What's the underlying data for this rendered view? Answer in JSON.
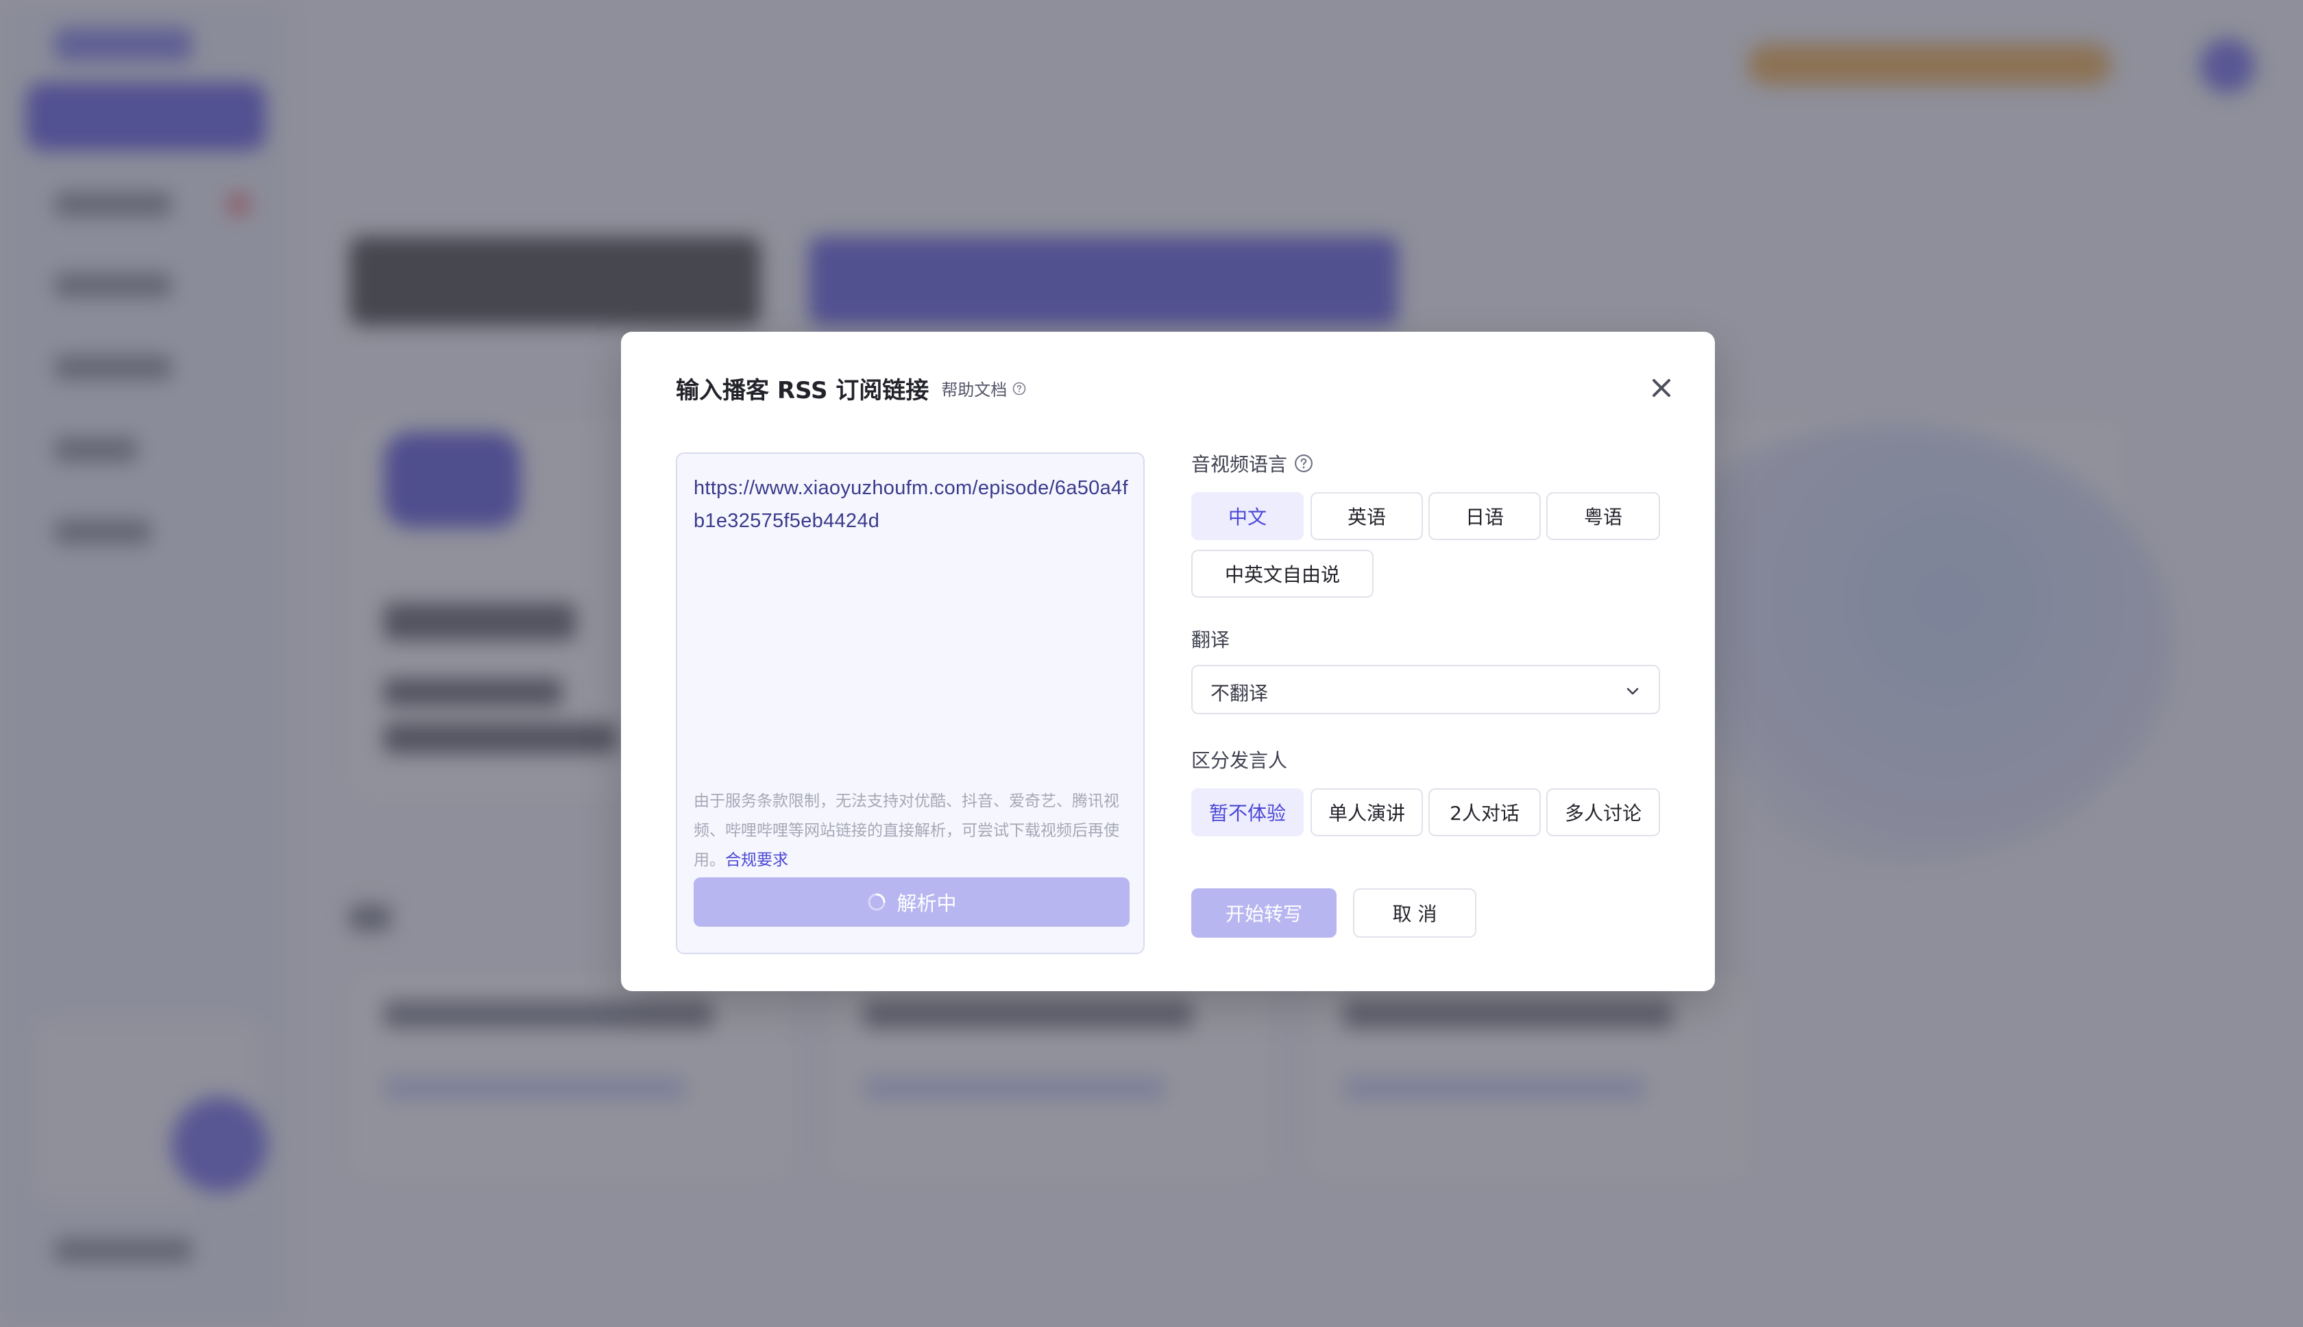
{
  "modal": {
    "title": "输入播客 RSS 订阅链接",
    "help_link": "帮助文档",
    "url_value": "https://www.xiaoyuzhoufm.com/episode/6a50a4fb1e32575f5eb4424d",
    "notice_text": "由于服务条款限制，无法支持对优酷、抖音、爱奇艺、腾讯视频、哔哩哔哩等网站链接的直接解析，可尝试下载视频后再使用。",
    "compliance_link": "合规要求",
    "parse_button": "解析中",
    "language": {
      "label": "音视频语言",
      "options": [
        "中文",
        "英语",
        "日语",
        "粤语",
        "中英文自由说"
      ],
      "selected": "中文"
    },
    "translation": {
      "label": "翻译",
      "selected_value": "不翻译"
    },
    "speaker": {
      "label": "区分发言人",
      "options": [
        "暂不体验",
        "单人演讲",
        "2人对话",
        "多人讨论"
      ],
      "selected": "暂不体验"
    },
    "start_button": "开始转写",
    "cancel_button": "取 消"
  },
  "colors": {
    "accent": "#4a47d6",
    "accent_light": "#eeedfd",
    "disabled_button": "#b8b6f0",
    "overlay": "#585864"
  },
  "icons": {
    "close": "close-icon",
    "help": "question-circle-icon",
    "spinner": "spinner-icon",
    "chevron": "chevron-down-icon"
  }
}
